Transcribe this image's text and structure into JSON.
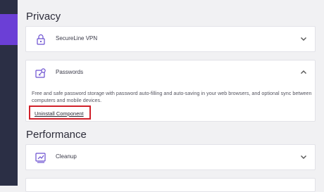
{
  "privacy": {
    "title": "Privacy",
    "vpn": {
      "label": "SecureLine VPN"
    },
    "passwords": {
      "label": "Passwords",
      "description": "Free and safe password storage with password auto-filling and auto-saving in your web browsers, and optional sync between computers and mobile devices.",
      "uninstall_label": "Uninstall Component"
    }
  },
  "performance": {
    "title": "Performance",
    "cleanup": {
      "label": "Cleanup"
    }
  },
  "colors": {
    "sidebar": "#2b2f45",
    "accent": "#6b3fd6",
    "highlight": "#d0202a",
    "icon": "#6b4fd0"
  },
  "icons": {
    "vpn": "lock-icon",
    "passwords": "password-key-icon",
    "cleanup": "cleanup-icon",
    "expand": "chevron-down-icon",
    "collapse": "chevron-up-icon"
  }
}
